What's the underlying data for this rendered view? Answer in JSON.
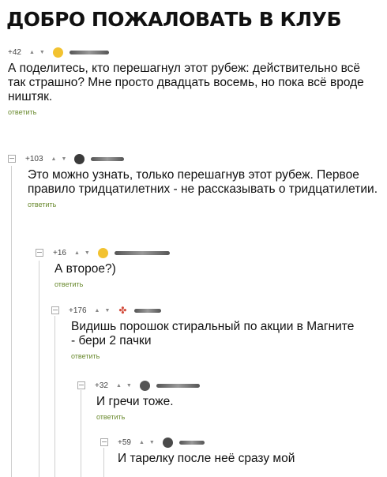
{
  "page": {
    "title": "ДОБРО ПОЖАЛОВАТЬ В КЛУБ"
  },
  "comments": [
    {
      "rating": "+42",
      "body": "А поделитесь, кто перешагнул этот рубеж: действительно всё так страшно? Мне просто двадцать восемь, но пока всё вроде ништяк.",
      "reply": "ответить",
      "avatar": "smiley-avatar-icon"
    },
    {
      "rating": "+103",
      "body": "Это можно узнать, только перешагнув этот рубеж. Первое правило тридцатилетних - не рассказывать о тридцатилетии.",
      "reply": "ответить",
      "avatar": "user-avatar-icon"
    },
    {
      "rating": "+16",
      "body": "А второе?)",
      "reply": "ответить",
      "avatar": "smiley-avatar-icon"
    },
    {
      "rating": "+176",
      "body": "Видишь порошок стиральный по акции в Магните - бери 2 пачки",
      "reply": "ответить",
      "avatar": "tree-avatar-icon"
    },
    {
      "rating": "+32",
      "body": "И гречи тоже.",
      "reply": "ответить",
      "avatar": "user-avatar-icon"
    },
    {
      "rating": "+59",
      "body": "И тарелку после неё сразу мой",
      "reply": "",
      "avatar": "user-avatar-icon"
    }
  ]
}
